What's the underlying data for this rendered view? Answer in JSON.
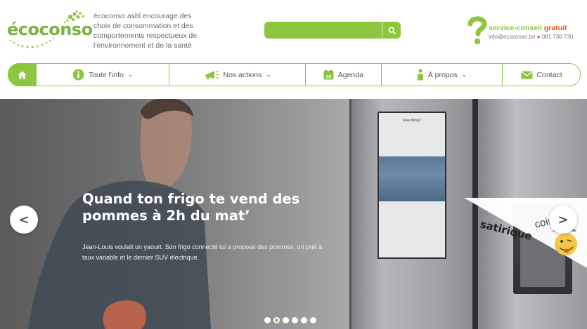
{
  "brand": {
    "logo_text": "écoconso",
    "tagline": "écoconso asbl encourage des choix de consommation et des comportements respectueux de l'environnement et de la santé"
  },
  "search": {
    "placeholder": ""
  },
  "service": {
    "title_part1": "service-conseil",
    "title_part2": "gratuit",
    "email": "info@ecoconso.be",
    "phone": "081 730 730"
  },
  "nav": {
    "items": [
      {
        "label": "Toute l'info",
        "icon": "info-icon",
        "dropdown": true
      },
      {
        "label": "Nos actions",
        "icon": "megaphone-icon",
        "dropdown": true
      },
      {
        "label": "Agenda",
        "icon": "calendar-icon",
        "dropdown": false
      },
      {
        "label": "À propos",
        "icon": "person-icon",
        "dropdown": true
      },
      {
        "label": "Contact",
        "icon": "envelope-icon",
        "dropdown": false
      }
    ]
  },
  "hero": {
    "title": "Quand ton frigo te vend des pommes à 2h du mat’",
    "description": "Jean-Louis voulait un yaourt. Son frigo connecté lui a proposé des pommes, un prêt à taux variable et le dernier SUV électrique.",
    "badge_line1": "coin",
    "badge_line2": "satirique",
    "screen_brand": "wasi thing2"
  },
  "slider": {
    "slide_count": 6,
    "active_index": 1
  },
  "colors": {
    "accent": "#8cc63f",
    "orange": "#e8541e",
    "text": "#555555"
  }
}
